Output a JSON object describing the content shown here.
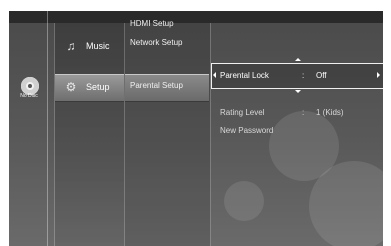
{
  "disc": {
    "label": "No Disc",
    "icon": "disc-icon"
  },
  "main_menu": [
    {
      "label": "Music",
      "icon": "music-note-icon",
      "selected": false
    },
    {
      "label": "Setup",
      "icon": "gear-icon",
      "selected": true
    }
  ],
  "sub_menu": [
    {
      "label": "HDMI Setup"
    },
    {
      "label": "Network Setup"
    },
    {
      "label": "Parental Setup",
      "selected": true
    }
  ],
  "options": [
    {
      "label": "Parental Lock",
      "separator": ":",
      "value": "Off",
      "active": true
    },
    {
      "label": "Rating Level",
      "separator": ":",
      "value": "1 (Kids)",
      "active": false
    },
    {
      "label": "New Password",
      "separator": "",
      "value": "",
      "active": false
    }
  ]
}
